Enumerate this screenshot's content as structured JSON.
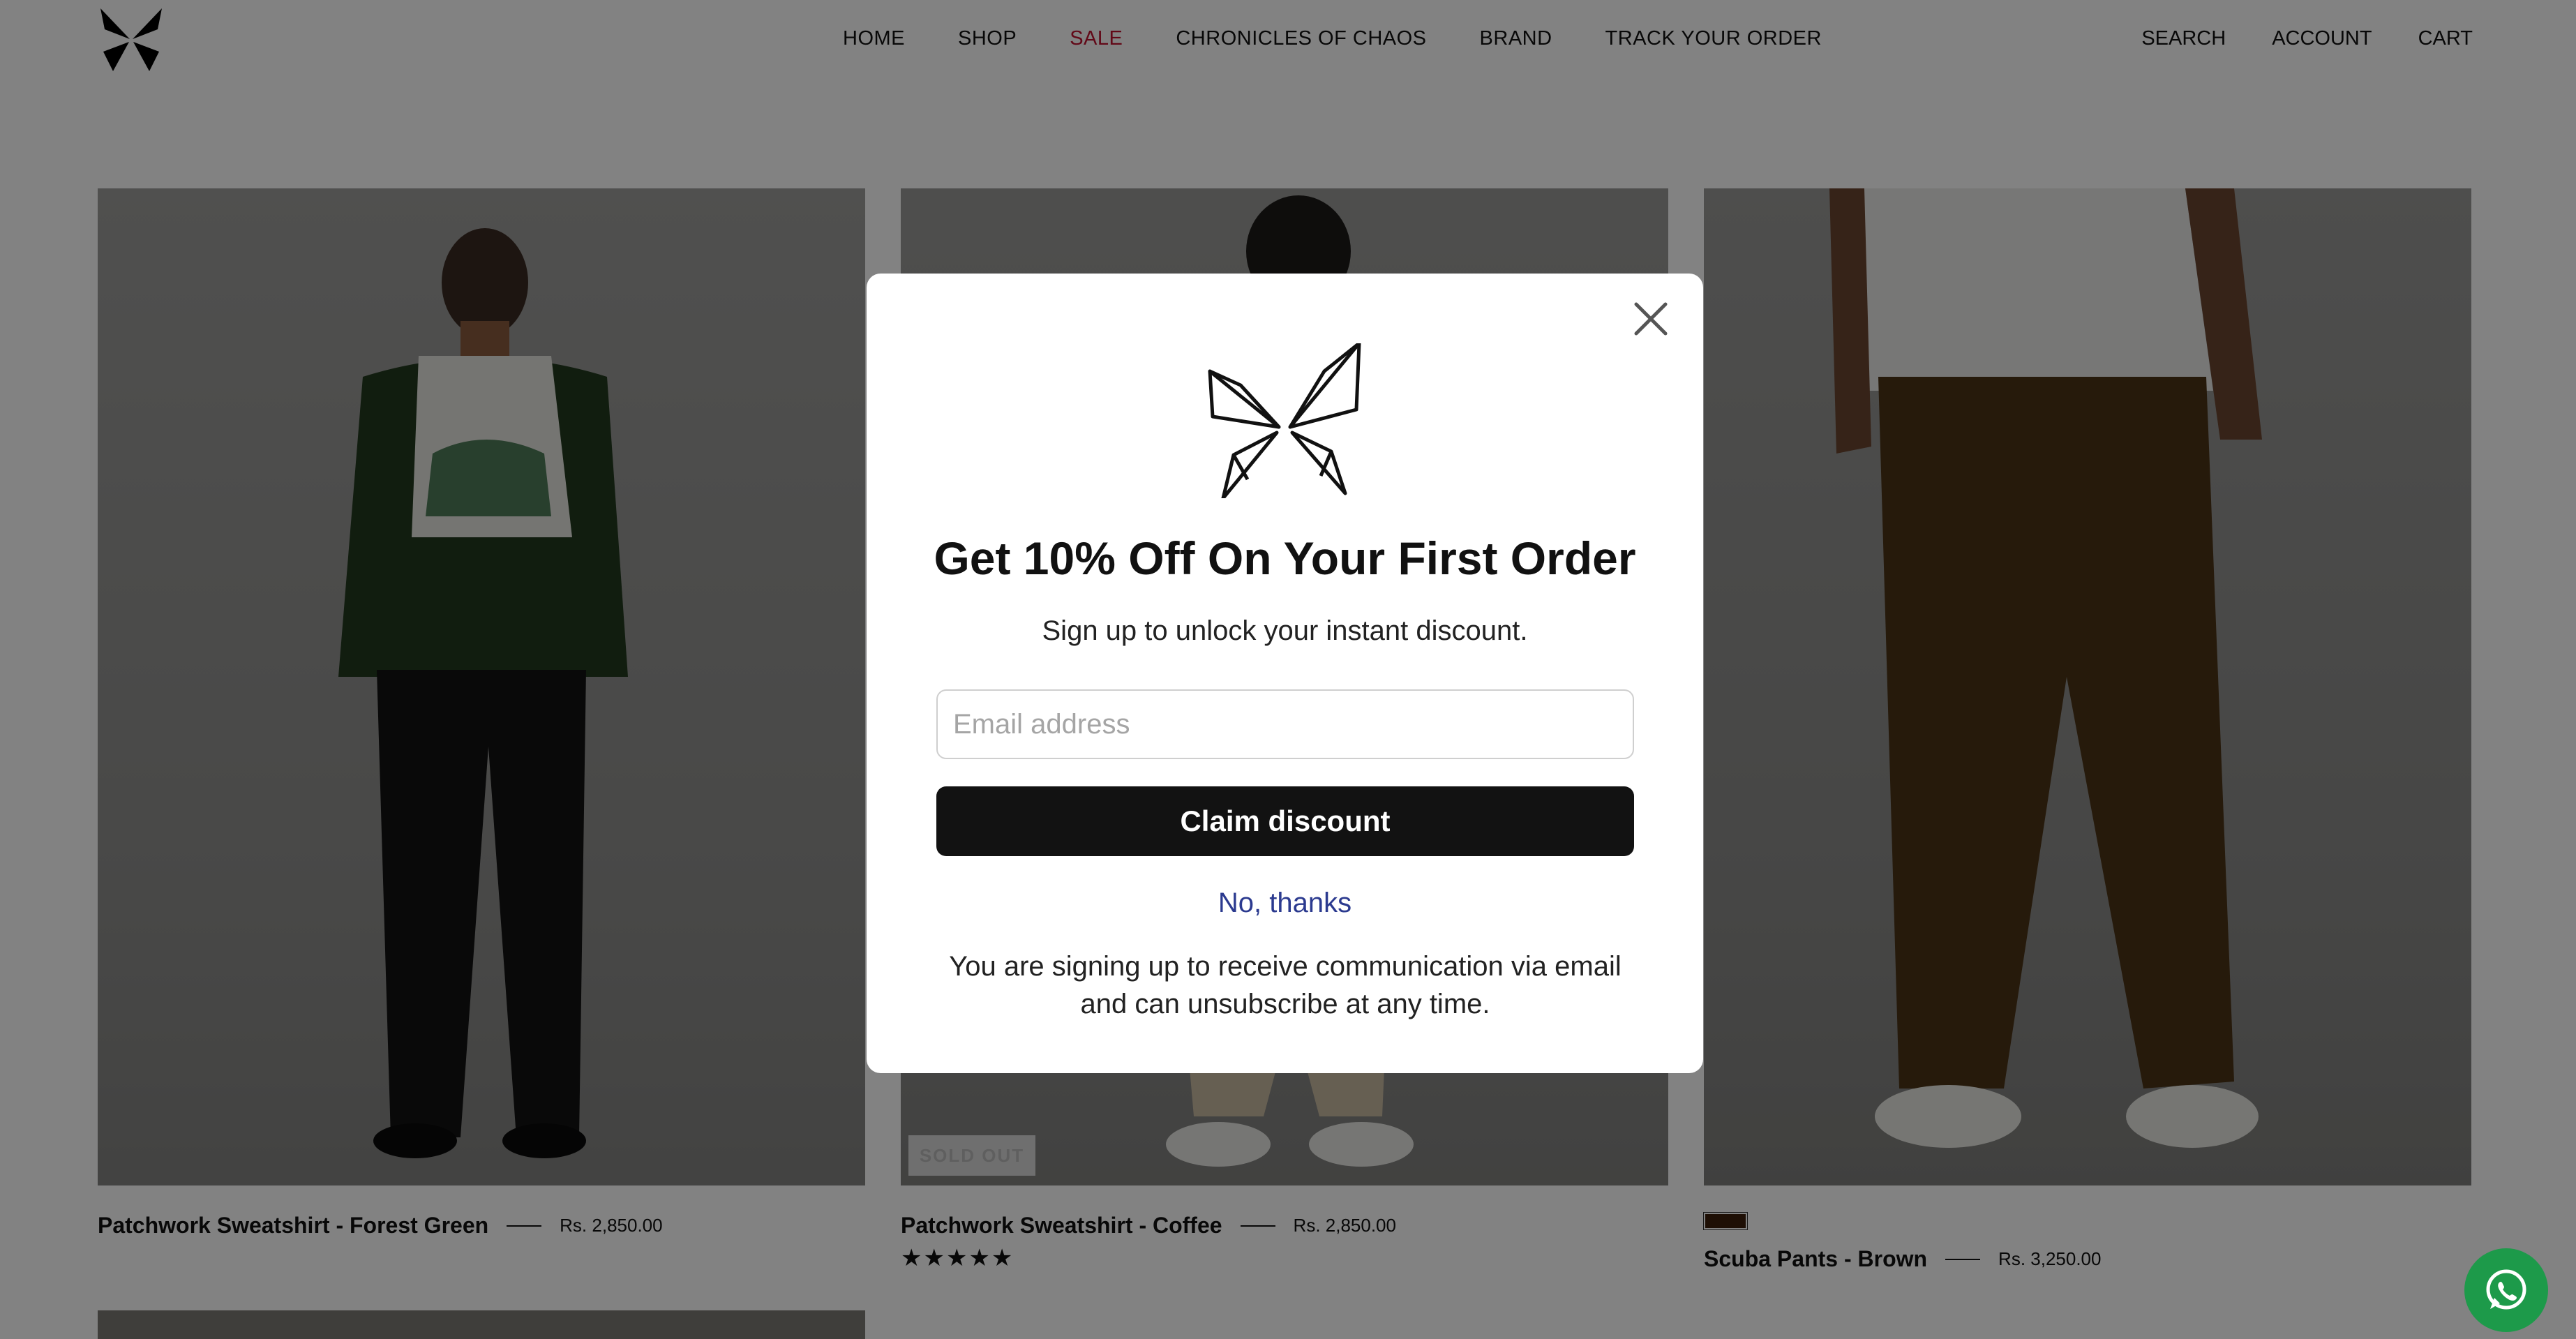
{
  "header": {
    "nav": [
      "HOME",
      "SHOP",
      "SALE",
      "CHRONICLES OF CHAOS",
      "BRAND",
      "TRACK YOUR ORDER"
    ],
    "utility": [
      "SEARCH",
      "ACCOUNT",
      "CART"
    ],
    "colors": {
      "sale": "#c1122f"
    }
  },
  "products": [
    {
      "name": "Patchwork Sweatshirt - Forest Green",
      "price": "Rs. 2,850.00"
    },
    {
      "name": "Patchwork Sweatshirt - Coffee",
      "price": "Rs. 2,850.00",
      "badge": "SOLD OUT",
      "rating": 5,
      "rating_stars": "★★★★★"
    },
    {
      "name": "Scuba Pants - Brown",
      "price": "Rs. 3,250.00",
      "swatch_color": "#3b1f0b"
    }
  ],
  "popup": {
    "title": "Get 10% Off On Your First Order",
    "subtitle": "Sign up to unlock your instant discount.",
    "email_placeholder": "Email address",
    "email_value": "",
    "claim_label": "Claim discount",
    "decline_label": "No, thanks",
    "legal": "You are signing up to receive communication via email and can unsubscribe at any time."
  },
  "icons": [
    "butterfly-logo-icon",
    "close-icon",
    "whatsapp-icon"
  ]
}
